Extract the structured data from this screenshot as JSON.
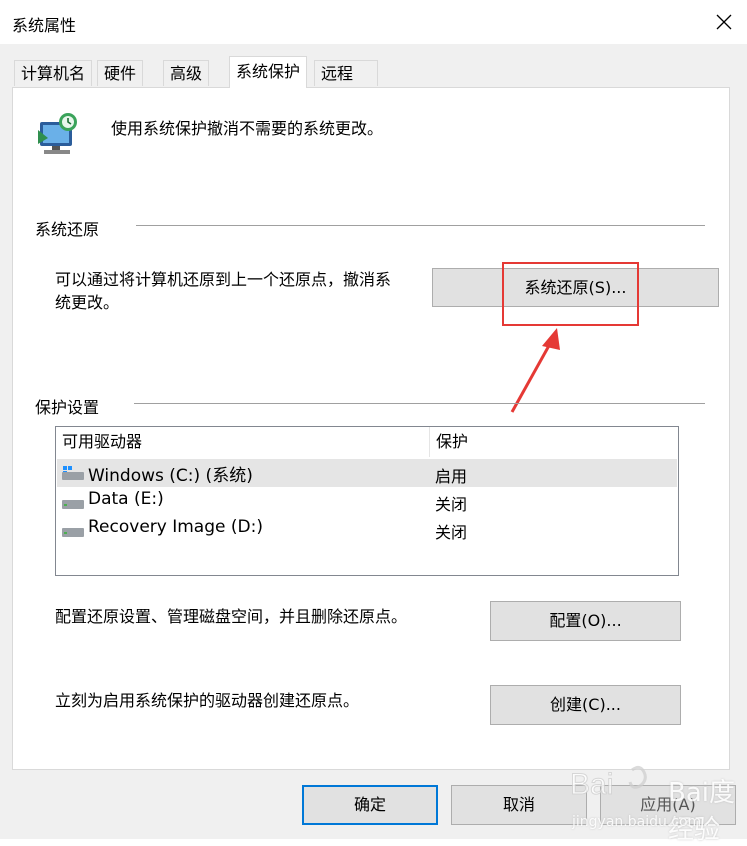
{
  "window": {
    "title": "系统属性"
  },
  "tabs": [
    {
      "label": "计算机名"
    },
    {
      "label": "硬件"
    },
    {
      "label": "高级"
    },
    {
      "label": "系统保护",
      "active": true
    },
    {
      "label": "远程"
    }
  ],
  "intro": {
    "text": "使用系统保护撤消不需要的系统更改。"
  },
  "restore": {
    "section_title": "系统还原",
    "description_line1": "可以通过将计算机还原到上一个还原点，撤消系",
    "description_line2": "统更改。",
    "button_label": "系统还原(S)..."
  },
  "protection": {
    "section_title": "保护设置",
    "columns": [
      "可用驱动器",
      "保护"
    ],
    "drives": [
      {
        "name": "Windows (C:) (系统)",
        "status": "启用",
        "icon": "windows-drive-icon",
        "selected": true
      },
      {
        "name": "Data (E:)",
        "status": "关闭",
        "icon": "drive-icon"
      },
      {
        "name": "Recovery Image (D:)",
        "status": "关闭",
        "icon": "drive-icon"
      }
    ],
    "configure_text": "配置还原设置、管理磁盘空间，并且删除还原点。",
    "configure_button": "配置(O)...",
    "create_text": "立刻为启用系统保护的驱动器创建还原点。",
    "create_button": "创建(C)..."
  },
  "footer": {
    "ok": "确定",
    "cancel": "取消",
    "apply": "应用(A)"
  },
  "watermark": {
    "text": "Bai度经验",
    "url_text": "jingyan.baidu.com"
  },
  "colors": {
    "highlight": "#e53935",
    "accent": "#0078d7",
    "dialog_bg": "#f0f0f0"
  }
}
